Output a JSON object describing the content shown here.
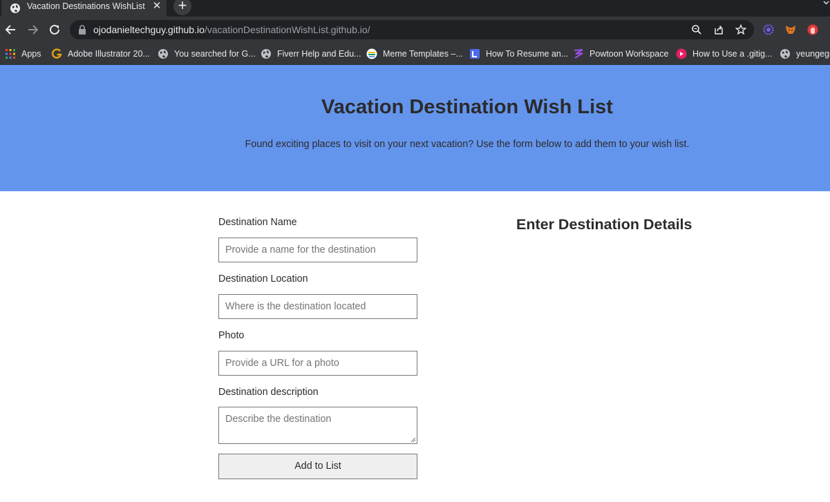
{
  "browser": {
    "tab": {
      "title": "Vacation Destinations WishList",
      "close_glyph": "✕",
      "favicon": "globe-icon"
    },
    "new_tab_glyph": "+",
    "address": {
      "host": "ojodanieltechguy.github.io",
      "path": "/vacationDestinationWishList.github.io/"
    },
    "bookmarks": [
      {
        "label": "Apps",
        "icon": "apps-grid-icon"
      },
      {
        "label": "Adobe Illustrator 20...",
        "icon": "g-logo-icon"
      },
      {
        "label": "You searched for G...",
        "icon": "globe-icon"
      },
      {
        "label": "Fiverr Help and Edu...",
        "icon": "globe-icon"
      },
      {
        "label": "Meme Templates –...",
        "icon": "meme-site-icon"
      },
      {
        "label": "How To Resume an...",
        "icon": "doc-site-icon"
      },
      {
        "label": "Powtoon Workspace",
        "icon": "powtoon-icon"
      },
      {
        "label": "How to Use a .gitig...",
        "icon": "play-circle-icon"
      },
      {
        "label": "yeungegs",
        "icon": "globe-icon"
      }
    ],
    "extensions": [
      "gear-flower-extension-icon",
      "fox-extension-icon",
      "red-hand-extension-icon"
    ]
  },
  "hero": {
    "title": "Vacation Destination Wish List",
    "subtitle": "Found exciting places to visit on your next vacation? Use the form below to add them to your wish list.",
    "background": "#6495ed"
  },
  "form": {
    "name_label": "Destination Name",
    "name_placeholder": "Provide a name for the destination",
    "location_label": "Destination Location",
    "location_placeholder": "Where is the destination located",
    "photo_label": "Photo",
    "photo_placeholder": "Provide a URL for a photo",
    "description_label": "Destination description",
    "description_placeholder": "Describe the destination",
    "submit_label": "Add to List"
  },
  "details": {
    "heading": "Enter Destination Details"
  }
}
